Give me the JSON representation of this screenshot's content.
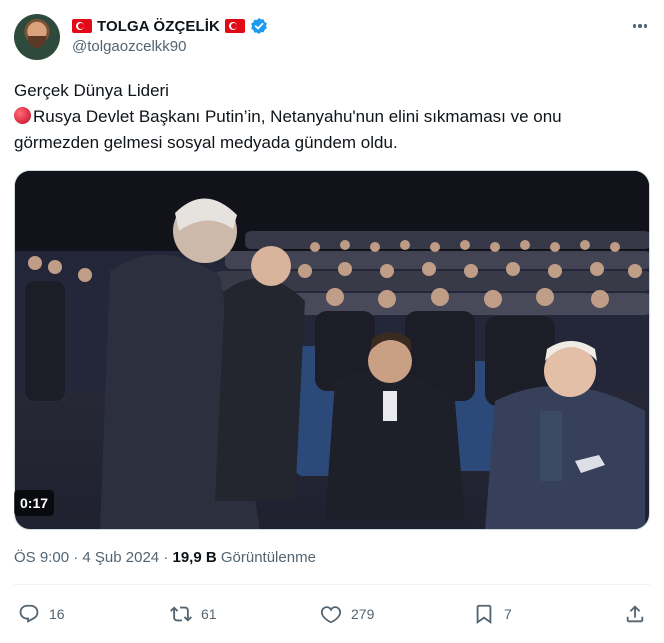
{
  "author": {
    "display_name": "TOLGA ÖZÇELİK",
    "handle": "@tolgaozcelkk90",
    "verified": true,
    "flag_left_icon": "turkey-flag-icon",
    "flag_right_icon": "turkey-flag-icon"
  },
  "tweet": {
    "line1": "Gerçek Dünya Lideri",
    "line2": "Rusya Devlet Başkanı Putin’in, Netanyahu'nun elini sıkmaması ve onu",
    "line3": "görmezden gelmesi sosyal medyada gündem oldu.",
    "bullet_icon": "red-circle-icon"
  },
  "media": {
    "type": "video",
    "duration": "0:17"
  },
  "meta": {
    "time": "ÖS 9:00",
    "separator": "·",
    "date": "4 Şub 2024",
    "views_count": "19,9 B",
    "views_label": "Görüntülenme"
  },
  "actions": {
    "reply_count": "16",
    "retweet_count": "61",
    "like_count": "279",
    "bookmark_count": "7"
  },
  "colors": {
    "text_primary": "#0f1419",
    "text_secondary": "#536471",
    "verified_blue": "#1d9bf0",
    "divider": "#eff3f4"
  }
}
